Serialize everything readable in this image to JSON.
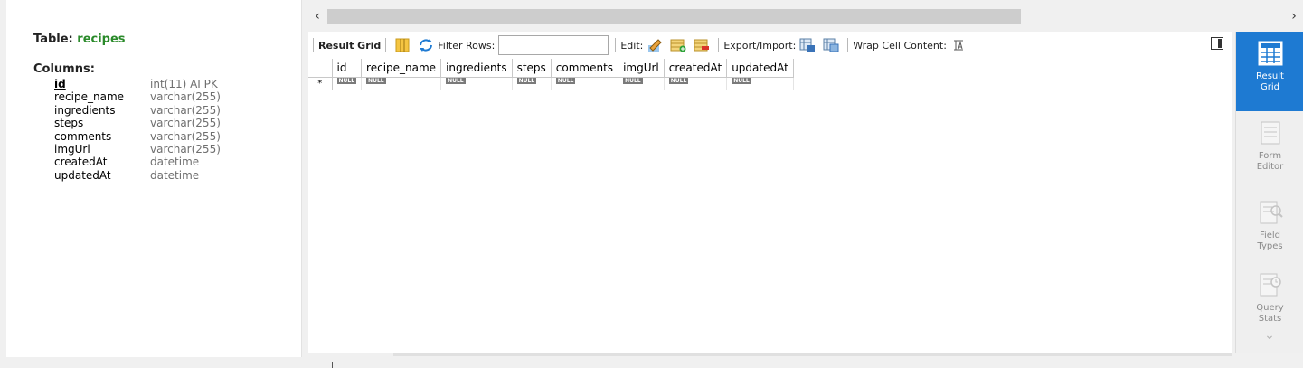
{
  "info": {
    "table_prefix": "Table: ",
    "table_name": "recipes",
    "columns_title": "Columns:",
    "columns": [
      {
        "name": "id",
        "type": "int(11) AI PK"
      },
      {
        "name": "recipe_name",
        "type": "varchar(255)"
      },
      {
        "name": "ingredients",
        "type": "varchar(255)"
      },
      {
        "name": "steps",
        "type": "varchar(255)"
      },
      {
        "name": "comments",
        "type": "varchar(255)"
      },
      {
        "name": "imgUrl",
        "type": "varchar(255)"
      },
      {
        "name": "createdAt",
        "type": "datetime"
      },
      {
        "name": "updatedAt",
        "type": "datetime"
      }
    ]
  },
  "toolbar": {
    "result_grid": "Result Grid",
    "filter_rows": "Filter Rows:",
    "filter_value": "",
    "edit": "Edit:",
    "export_import": "Export/Import:",
    "wrap_cell": "Wrap Cell Content:"
  },
  "grid": {
    "headers": [
      "id",
      "recipe_name",
      "ingredients",
      "steps",
      "comments",
      "imgUrl",
      "createdAt",
      "updatedAt"
    ],
    "new_row_marker": "*",
    "null_label": "NULL"
  },
  "side_panel": {
    "result_grid": "Result\nGrid",
    "form_editor": "Form\nEditor",
    "field_types": "Field\nTypes",
    "query_stats": "Query\nStats"
  },
  "colors": {
    "accent": "#1e7ad2",
    "table_name": "#2a8a2a"
  }
}
